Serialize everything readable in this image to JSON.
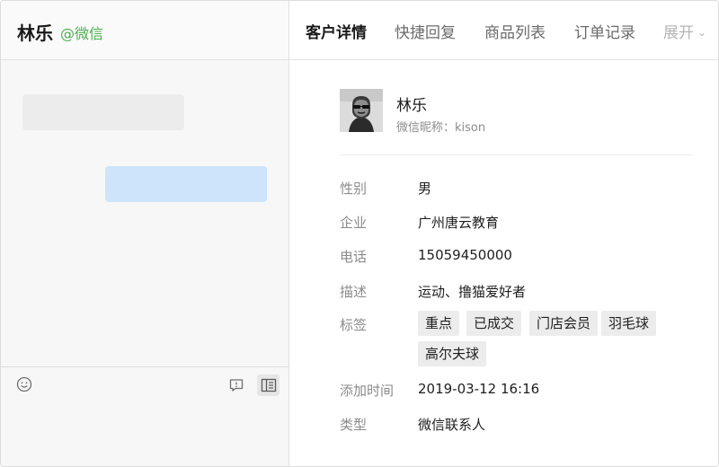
{
  "chat": {
    "name": "林乐",
    "source": "@微信"
  },
  "composer": {
    "icons": [
      "emoji-icon",
      "comment-icon",
      "side-panel-icon"
    ]
  },
  "tabs": [
    {
      "label": "客户详情",
      "active": true
    },
    {
      "label": "快捷回复",
      "active": false
    },
    {
      "label": "商品列表",
      "active": false
    },
    {
      "label": "订单记录",
      "active": false
    }
  ],
  "tabs_more": {
    "label": "展开"
  },
  "profile": {
    "name": "林乐",
    "nickname": "微信昵称：kison"
  },
  "fields": {
    "gender": {
      "label": "性别",
      "value": "男"
    },
    "company": {
      "label": "企业",
      "value": "广州唐云教育"
    },
    "phone": {
      "label": "电话",
      "value": "15059450000"
    },
    "description": {
      "label": "描述",
      "value": "运动、撸猫爱好者"
    },
    "tags": {
      "label": "标签",
      "items": [
        "重点",
        "已成交",
        "门店会员",
        "羽毛球",
        "高尔夫球"
      ]
    },
    "added_time": {
      "label": "添加时间",
      "value": "2019-03-12 16:16"
    },
    "type": {
      "label": "类型",
      "value": "微信联系人"
    }
  },
  "colors": {
    "source_green": "#4caf50",
    "bubble_outgoing": "#cde4fb",
    "bubble_incoming": "#ececec",
    "tag_bg": "#ececec"
  }
}
